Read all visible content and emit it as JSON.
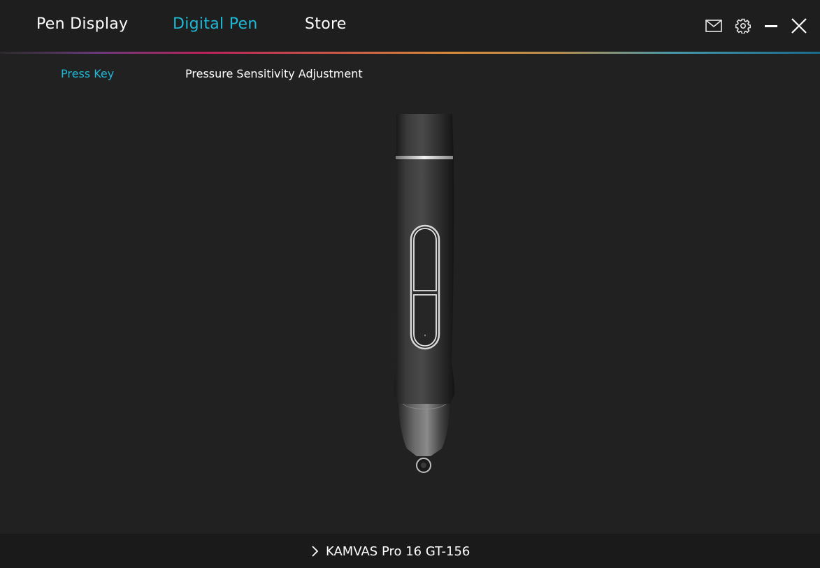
{
  "header": {
    "tabs": [
      {
        "label": "Pen Display",
        "active": false
      },
      {
        "label": "Digital Pen",
        "active": true
      },
      {
        "label": "Store",
        "active": false
      }
    ],
    "controls": [
      "mail-icon",
      "gear-icon",
      "minimize-icon",
      "close-icon"
    ]
  },
  "subtabs": [
    {
      "label": "Press Key",
      "active": true
    },
    {
      "label": "Pressure Sensitivity Adjustment",
      "active": false
    }
  ],
  "footer": {
    "device": "KAMVAS Pro 16 GT-156",
    "icon": "chevron-right-icon"
  },
  "colors": {
    "accent": "#1fb8d6",
    "background": "#212121",
    "header": "#1e1e1e",
    "footer": "#1a1a1a",
    "text": "#ffffff"
  }
}
